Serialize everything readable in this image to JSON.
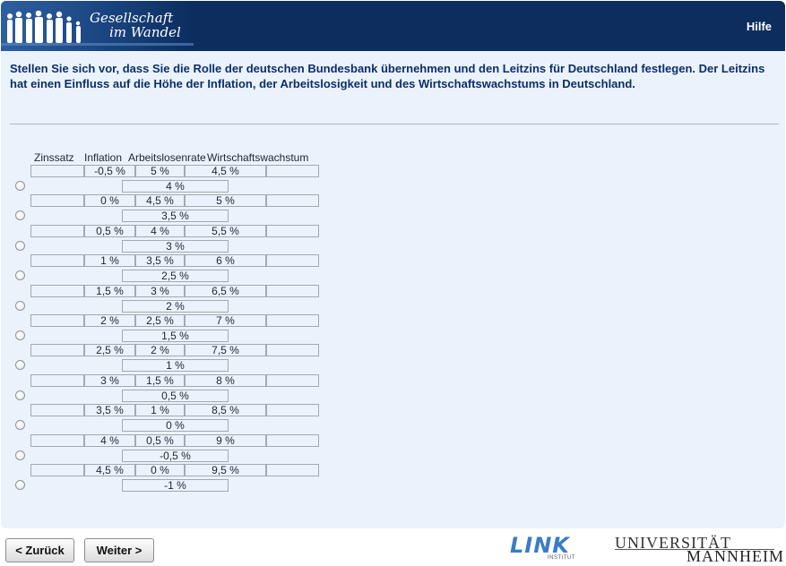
{
  "header": {
    "logo_line1": "Gesellschaft",
    "logo_line2": "im Wandel",
    "help": "Hilfe"
  },
  "question": "Stellen Sie sich vor, dass Sie die Rolle der deutschen Bundesbank übernehmen und den Leitzins für Deutschland festlegen. Der Leitzins hat einen Einfluss auf die Höhe der Inflation, der Arbeitslosigkeit und des Wirtschaftswachstums in Deutschland.",
  "columns": {
    "rate": "Zinssatz",
    "inflation": "Inflation",
    "unemployment": "Arbeitslosenrate",
    "growth": "Wirtschaftswachstum"
  },
  "options": [
    {
      "inflation": "-0,5 %",
      "unemployment": "5 %",
      "growth": "4,5 %",
      "rate": "4 %"
    },
    {
      "inflation": "0 %",
      "unemployment": "4,5 %",
      "growth": "5 %",
      "rate": "3,5 %"
    },
    {
      "inflation": "0,5 %",
      "unemployment": "4 %",
      "growth": "5,5 %",
      "rate": "3 %"
    },
    {
      "inflation": "1 %",
      "unemployment": "3,5 %",
      "growth": "6 %",
      "rate": "2,5 %"
    },
    {
      "inflation": "1,5 %",
      "unemployment": "3 %",
      "growth": "6,5 %",
      "rate": "2 %"
    },
    {
      "inflation": "2 %",
      "unemployment": "2,5 %",
      "growth": "7 %",
      "rate": "1,5 %"
    },
    {
      "inflation": "2,5 %",
      "unemployment": "2 %",
      "growth": "7,5 %",
      "rate": "1 %"
    },
    {
      "inflation": "3 %",
      "unemployment": "1,5 %",
      "growth": "8 %",
      "rate": "0,5 %"
    },
    {
      "inflation": "3,5 %",
      "unemployment": "1 %",
      "growth": "8,5 %",
      "rate": "0 %"
    },
    {
      "inflation": "4 %",
      "unemployment": "0,5 %",
      "growth": "9 %",
      "rate": "-0,5 %"
    },
    {
      "inflation": "4,5 %",
      "unemployment": "0 %",
      "growth": "9,5 %",
      "rate": "-1 %"
    }
  ],
  "nav": {
    "back": "< Zurück",
    "next": "Weiter >"
  },
  "footer": {
    "link_logo": "LINK",
    "link_sub": "INSTITUT",
    "uni_top": "UNIVERSITÄT",
    "uni_bottom": "MANNHEIM"
  },
  "colors": {
    "header_bg": "#0c2d5e",
    "content_bg": "#eaf2fc",
    "question_text": "#0d2e6b",
    "link_logo": "#3b7cc4"
  }
}
